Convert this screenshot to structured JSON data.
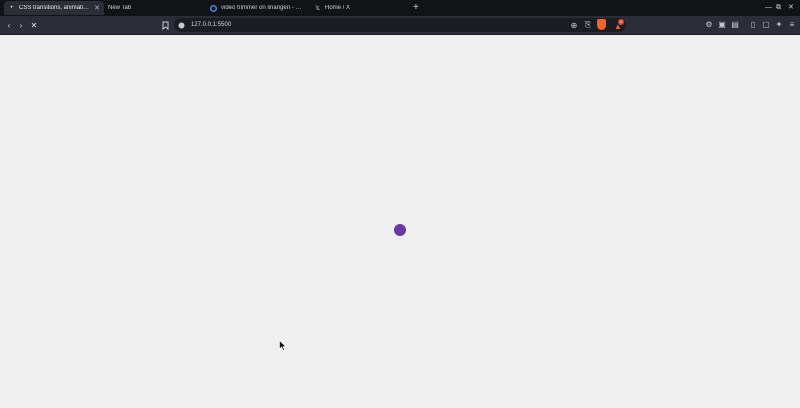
{
  "browser": {
    "tabs": [
      {
        "label": "CSS transitions, animations",
        "icon": "page-icon",
        "active": true
      },
      {
        "label": "New Tab",
        "icon": "",
        "active": false
      },
      {
        "label": "video trimmer on linangen - Gri",
        "icon": "google-icon",
        "active": false
      },
      {
        "label": "Home / X",
        "icon": "x-icon",
        "active": false
      }
    ],
    "new_tab_symbol": "+",
    "url": "127.0.0.1:5500",
    "shield_badge": "1"
  },
  "page": {
    "dot_color": "#6a38a3",
    "background_color": "#f2f2f2"
  }
}
